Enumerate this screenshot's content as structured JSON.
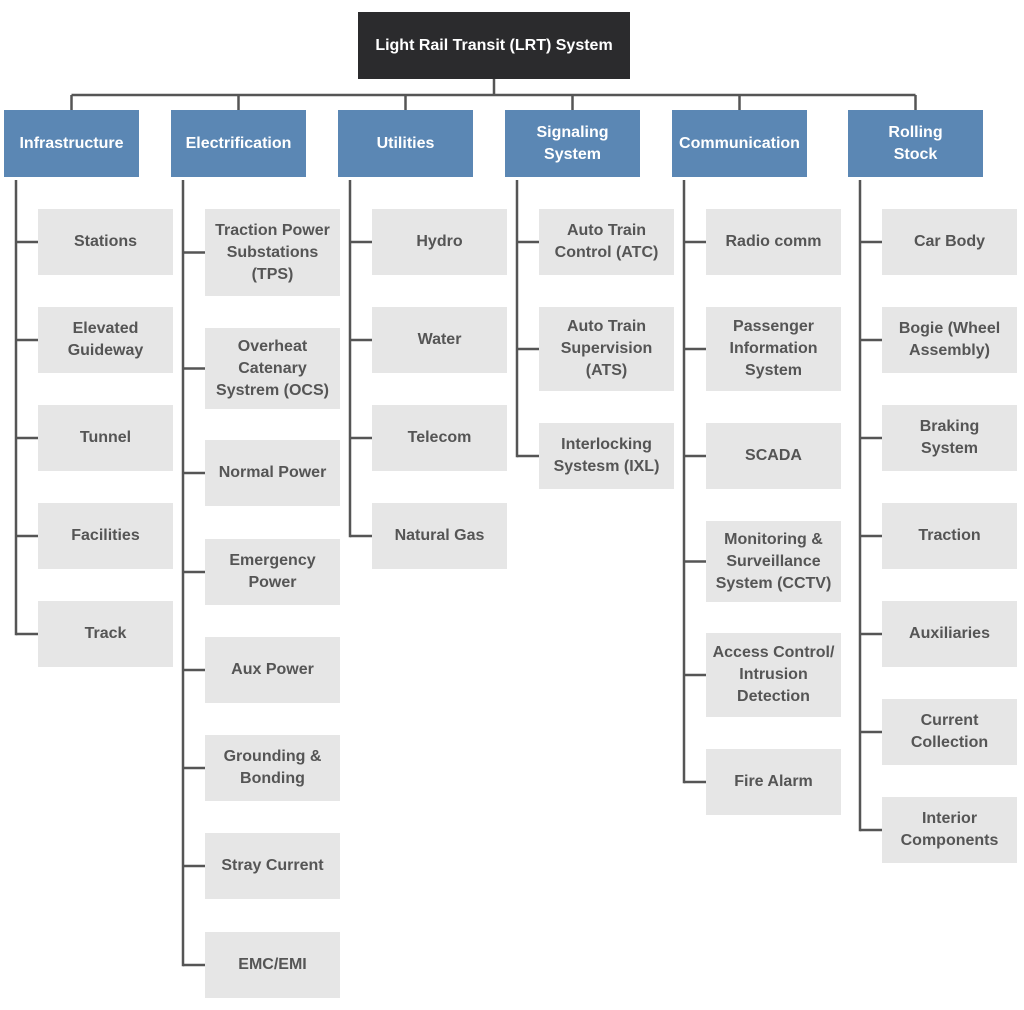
{
  "root": {
    "label": "Light Rail Transit (LRT) System"
  },
  "colors": {
    "root": "#2b2b2d",
    "category": "#5b87b4",
    "leaf": "#e6e6e6",
    "connector": "#555555"
  },
  "categories": [
    {
      "label": "Infrastructure",
      "items": [
        "Stations",
        "Elevated\nGuideway",
        "Tunnel",
        "Facilities",
        "Track"
      ]
    },
    {
      "label": "Electrification",
      "items": [
        "Traction Power\nSubstations\n(TPS)",
        "Overheat\nCatenary\nSystrem (OCS)",
        "Normal Power",
        "Emergency\nPower",
        "Aux Power",
        "Grounding &\nBonding",
        "Stray Current",
        "EMC/EMI"
      ]
    },
    {
      "label": "Utilities",
      "items": [
        "Hydro",
        "Water",
        "Telecom",
        "Natural Gas"
      ]
    },
    {
      "label": "Signaling\nSystem",
      "items": [
        "Auto Train\nControl (ATC)",
        "Auto Train\nSupervision\n(ATS)",
        "Interlocking\nSystesm (IXL)"
      ]
    },
    {
      "label": "Communication",
      "items": [
        "Radio comm",
        "Passenger\nInformation\nSystem",
        "SCADA",
        "Monitoring &\nSurveillance\nSystem (CCTV)",
        "Access Control/\nIntrusion\nDetection",
        "Fire Alarm"
      ]
    },
    {
      "label": "Rolling\nStock",
      "items": [
        "Car Body",
        "Bogie (Wheel\nAssembly)",
        "Braking\nSystem",
        "Traction",
        "Auxiliaries",
        "Current\nCollection",
        "Interior\nComponents"
      ]
    }
  ]
}
